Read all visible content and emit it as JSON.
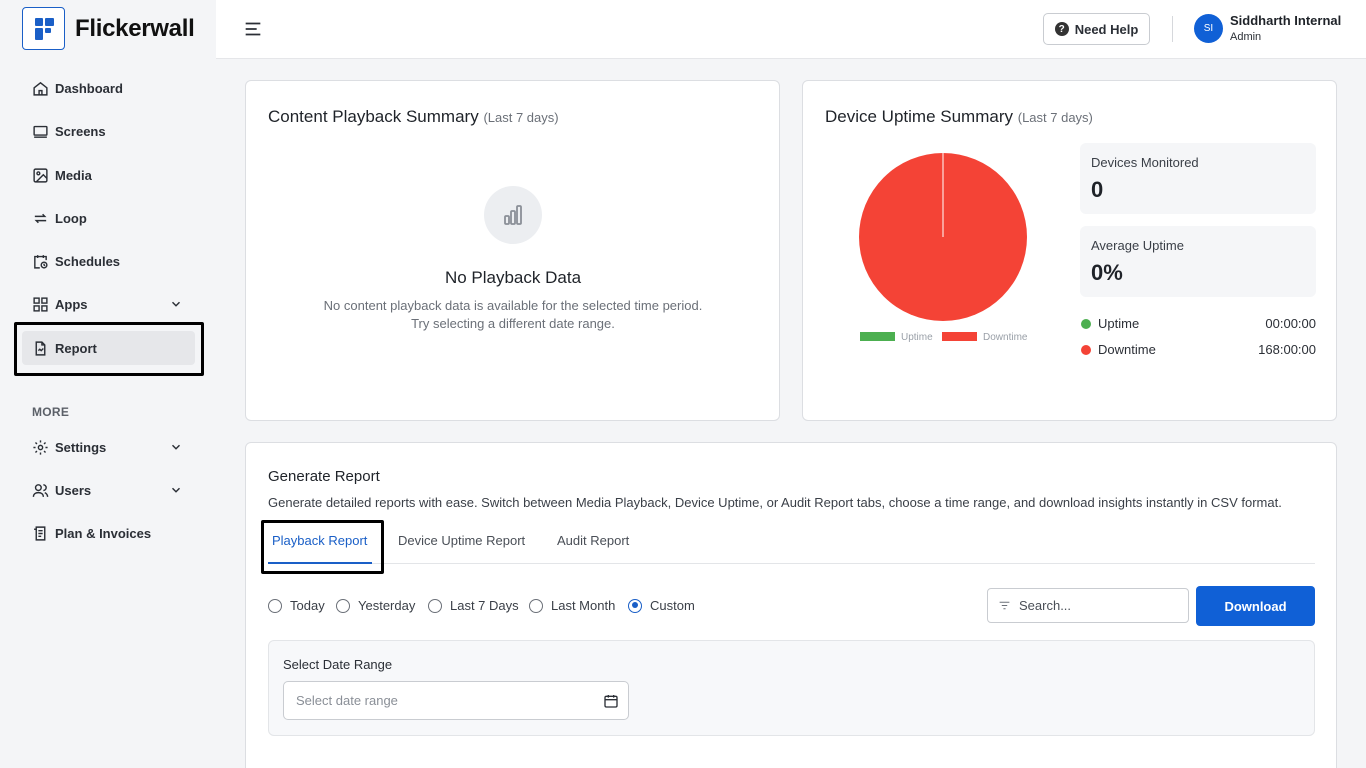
{
  "app": {
    "name": "Flickerwall"
  },
  "sidebar": {
    "items": [
      {
        "label": "Dashboard",
        "icon": "home-icon"
      },
      {
        "label": "Screens",
        "icon": "monitor-icon"
      },
      {
        "label": "Media",
        "icon": "image-icon"
      },
      {
        "label": "Loop",
        "icon": "loop-icon"
      },
      {
        "label": "Schedules",
        "icon": "calendar-clock-icon"
      },
      {
        "label": "Apps",
        "icon": "apps-grid-icon",
        "expandable": true
      },
      {
        "label": "Report",
        "icon": "report-icon",
        "active": true
      }
    ],
    "more_label": "MORE",
    "more_items": [
      {
        "label": "Settings",
        "icon": "gear-icon",
        "expandable": true
      },
      {
        "label": "Users",
        "icon": "users-icon",
        "expandable": true
      },
      {
        "label": "Plan & Invoices",
        "icon": "invoice-icon"
      }
    ]
  },
  "header": {
    "help_label": "Need Help",
    "user": {
      "initials": "SI",
      "name": "Siddharth Internal",
      "role": "Admin"
    }
  },
  "playback_summary": {
    "title": "Content Playback Summary",
    "period": "(Last 7 days)",
    "empty_title": "No Playback Data",
    "empty_line1": "No content playback data is available for the selected time period.",
    "empty_line2": "Try selecting a different date range."
  },
  "uptime_summary": {
    "title": "Device Uptime Summary",
    "period": "(Last 7 days)",
    "devices_monitored_label": "Devices Monitored",
    "devices_monitored_value": "0",
    "average_uptime_label": "Average Uptime",
    "average_uptime_value": "0%",
    "legend": [
      {
        "name": "Uptime",
        "value": "00:00:00",
        "color": "#4caf50"
      },
      {
        "name": "Downtime",
        "value": "168:00:00",
        "color": "#f44336"
      }
    ]
  },
  "chart_data": {
    "type": "pie",
    "categories": [
      "Uptime",
      "Downtime"
    ],
    "values": [
      0,
      168
    ],
    "colors": [
      "#4caf50",
      "#f44336"
    ],
    "legend_position": "bottom"
  },
  "generate_report": {
    "title": "Generate Report",
    "description": "Generate detailed reports with ease. Switch between Media Playback, Device Uptime, or Audit Report tabs, choose a time range, and download insights instantly in CSV format.",
    "tabs": [
      "Playback Report",
      "Device Uptime Report",
      "Audit Report"
    ],
    "active_tab": "Playback Report",
    "ranges": [
      "Today",
      "Yesterday",
      "Last 7 Days",
      "Last Month",
      "Custom"
    ],
    "selected_range": "Custom",
    "search_placeholder": "Search...",
    "download_label": "Download",
    "date_range_label": "Select Date Range",
    "date_range_placeholder": "Select date range"
  },
  "colors": {
    "primary": "#1060d6",
    "accent": "#1a5fc7"
  }
}
